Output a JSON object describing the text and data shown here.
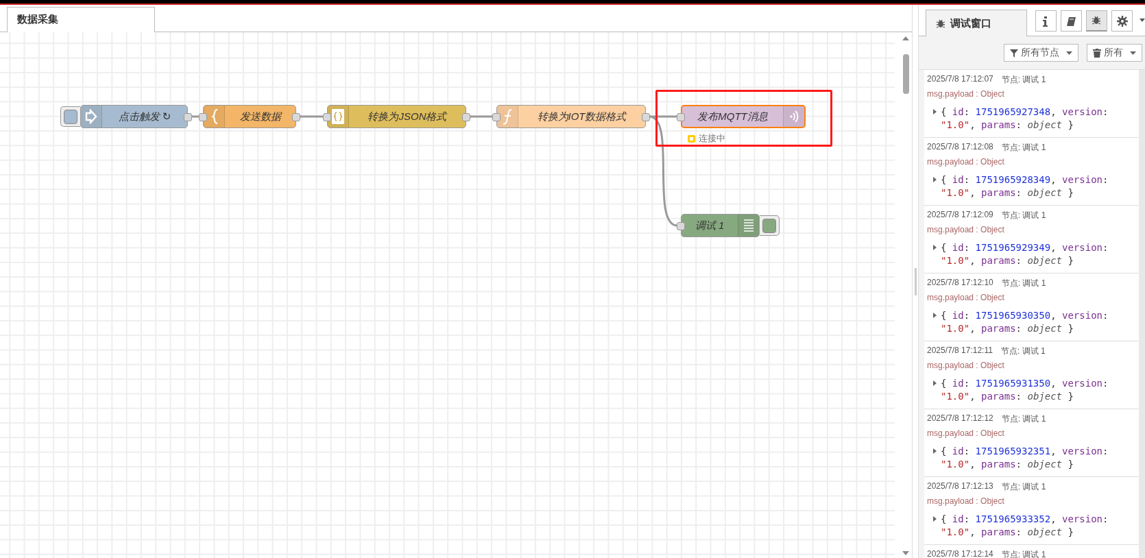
{
  "tabs": [
    {
      "label": "数据采集",
      "selected": true
    }
  ],
  "flow": {
    "nodes": [
      {
        "kind": "inject",
        "label": "点击触发 ↻",
        "color": "#a6bbcf",
        "selected": false
      },
      {
        "kind": "template",
        "label": "发送数据",
        "color": "#f3b567",
        "selected": false
      },
      {
        "kind": "json",
        "label": "转换为JSON格式",
        "color": "#debd5c",
        "selected": false
      },
      {
        "kind": "function",
        "label": "转换为IOT数据格式",
        "color": "#fdd0a2",
        "selected": false
      },
      {
        "kind": "mqtt-out",
        "label": "发布MQTT消息",
        "color": "#d8bfd8",
        "selected": true,
        "highlighted": true,
        "status": {
          "text": "连接中",
          "kind": "ring",
          "color": "#ffcc00"
        }
      },
      {
        "kind": "debug",
        "label": "调试 1",
        "color": "#87a980",
        "selected": false,
        "active": true
      }
    ]
  },
  "sidebar": {
    "tabs": [
      {
        "label": "调试窗口",
        "selected": true
      }
    ],
    "buttons": [
      {
        "kind": "info",
        "selected": false
      },
      {
        "kind": "help",
        "selected": false
      },
      {
        "kind": "debug",
        "selected": true
      },
      {
        "kind": "config",
        "selected": false
      }
    ],
    "filter": {
      "label": "所有节点"
    },
    "clear": {
      "label": "所有"
    },
    "messages": [
      {
        "time": "2025/7/8 17:12:07",
        "source": "节点: 调试 1",
        "topic": "msg.payload : Object",
        "expanded": false,
        "tokens": [
          {
            "text": "{ ",
            "kind": "punct"
          },
          {
            "text": "id",
            "kind": "key"
          },
          {
            "text": ": ",
            "kind": "punct"
          },
          {
            "text": "1751965927348",
            "kind": "number"
          },
          {
            "text": ", ",
            "kind": "punct"
          },
          {
            "text": "version",
            "kind": "key"
          },
          {
            "text": ": ",
            "kind": "punct"
          },
          {
            "text": "\"1.0\"",
            "kind": "string"
          },
          {
            "text": ", ",
            "kind": "punct"
          },
          {
            "text": "params",
            "kind": "key"
          },
          {
            "text": ": ",
            "kind": "punct"
          },
          {
            "text": "object",
            "kind": "type"
          },
          {
            "text": " }",
            "kind": "punct"
          }
        ]
      },
      {
        "time": "2025/7/8 17:12:08",
        "source": "节点: 调试 1",
        "topic": "msg.payload : Object",
        "expanded": false,
        "tokens": [
          {
            "text": "{ ",
            "kind": "punct"
          },
          {
            "text": "id",
            "kind": "key"
          },
          {
            "text": ": ",
            "kind": "punct"
          },
          {
            "text": "1751965928349",
            "kind": "number"
          },
          {
            "text": ", ",
            "kind": "punct"
          },
          {
            "text": "version",
            "kind": "key"
          },
          {
            "text": ": ",
            "kind": "punct"
          },
          {
            "text": "\"1.0\"",
            "kind": "string"
          },
          {
            "text": ", ",
            "kind": "punct"
          },
          {
            "text": "params",
            "kind": "key"
          },
          {
            "text": ": ",
            "kind": "punct"
          },
          {
            "text": "object",
            "kind": "type"
          },
          {
            "text": " }",
            "kind": "punct"
          }
        ]
      },
      {
        "time": "2025/7/8 17:12:09",
        "source": "节点: 调试 1",
        "topic": "msg.payload : Object",
        "expanded": false,
        "tokens": [
          {
            "text": "{ ",
            "kind": "punct"
          },
          {
            "text": "id",
            "kind": "key"
          },
          {
            "text": ": ",
            "kind": "punct"
          },
          {
            "text": "1751965929349",
            "kind": "number"
          },
          {
            "text": ", ",
            "kind": "punct"
          },
          {
            "text": "version",
            "kind": "key"
          },
          {
            "text": ": ",
            "kind": "punct"
          },
          {
            "text": "\"1.0\"",
            "kind": "string"
          },
          {
            "text": ", ",
            "kind": "punct"
          },
          {
            "text": "params",
            "kind": "key"
          },
          {
            "text": ": ",
            "kind": "punct"
          },
          {
            "text": "object",
            "kind": "type"
          },
          {
            "text": " }",
            "kind": "punct"
          }
        ]
      },
      {
        "time": "2025/7/8 17:12:10",
        "source": "节点: 调试 1",
        "topic": "msg.payload : Object",
        "expanded": false,
        "tokens": [
          {
            "text": "{ ",
            "kind": "punct"
          },
          {
            "text": "id",
            "kind": "key"
          },
          {
            "text": ": ",
            "kind": "punct"
          },
          {
            "text": "1751965930350",
            "kind": "number"
          },
          {
            "text": ", ",
            "kind": "punct"
          },
          {
            "text": "version",
            "kind": "key"
          },
          {
            "text": ": ",
            "kind": "punct"
          },
          {
            "text": "\"1.0\"",
            "kind": "string"
          },
          {
            "text": ", ",
            "kind": "punct"
          },
          {
            "text": "params",
            "kind": "key"
          },
          {
            "text": ": ",
            "kind": "punct"
          },
          {
            "text": "object",
            "kind": "type"
          },
          {
            "text": " }",
            "kind": "punct"
          }
        ]
      },
      {
        "time": "2025/7/8 17:12:11",
        "source": "节点: 调试 1",
        "topic": "msg.payload : Object",
        "expanded": false,
        "tokens": [
          {
            "text": "{ ",
            "kind": "punct"
          },
          {
            "text": "id",
            "kind": "key"
          },
          {
            "text": ": ",
            "kind": "punct"
          },
          {
            "text": "1751965931350",
            "kind": "number"
          },
          {
            "text": ", ",
            "kind": "punct"
          },
          {
            "text": "version",
            "kind": "key"
          },
          {
            "text": ": ",
            "kind": "punct"
          },
          {
            "text": "\"1.0\"",
            "kind": "string"
          },
          {
            "text": ", ",
            "kind": "punct"
          },
          {
            "text": "params",
            "kind": "key"
          },
          {
            "text": ": ",
            "kind": "punct"
          },
          {
            "text": "object",
            "kind": "type"
          },
          {
            "text": " }",
            "kind": "punct"
          }
        ]
      },
      {
        "time": "2025/7/8 17:12:12",
        "source": "节点: 调试 1",
        "topic": "msg.payload : Object",
        "expanded": false,
        "tokens": [
          {
            "text": "{ ",
            "kind": "punct"
          },
          {
            "text": "id",
            "kind": "key"
          },
          {
            "text": ": ",
            "kind": "punct"
          },
          {
            "text": "1751965932351",
            "kind": "number"
          },
          {
            "text": ", ",
            "kind": "punct"
          },
          {
            "text": "version",
            "kind": "key"
          },
          {
            "text": ": ",
            "kind": "punct"
          },
          {
            "text": "\"1.0\"",
            "kind": "string"
          },
          {
            "text": ", ",
            "kind": "punct"
          },
          {
            "text": "params",
            "kind": "key"
          },
          {
            "text": ": ",
            "kind": "punct"
          },
          {
            "text": "object",
            "kind": "type"
          },
          {
            "text": " }",
            "kind": "punct"
          }
        ]
      },
      {
        "time": "2025/7/8 17:12:13",
        "source": "节点: 调试 1",
        "topic": "msg.payload : Object",
        "expanded": false,
        "tokens": [
          {
            "text": "{ ",
            "kind": "punct"
          },
          {
            "text": "id",
            "kind": "key"
          },
          {
            "text": ": ",
            "kind": "punct"
          },
          {
            "text": "1751965933352",
            "kind": "number"
          },
          {
            "text": ", ",
            "kind": "punct"
          },
          {
            "text": "version",
            "kind": "key"
          },
          {
            "text": ": ",
            "kind": "punct"
          },
          {
            "text": "\"1.0\"",
            "kind": "string"
          },
          {
            "text": ", ",
            "kind": "punct"
          },
          {
            "text": "params",
            "kind": "key"
          },
          {
            "text": ": ",
            "kind": "punct"
          },
          {
            "text": "object",
            "kind": "type"
          },
          {
            "text": " }",
            "kind": "punct"
          }
        ]
      },
      {
        "time": "2025/7/8 17:12:14",
        "source": "节点: 调试 1"
      }
    ]
  }
}
